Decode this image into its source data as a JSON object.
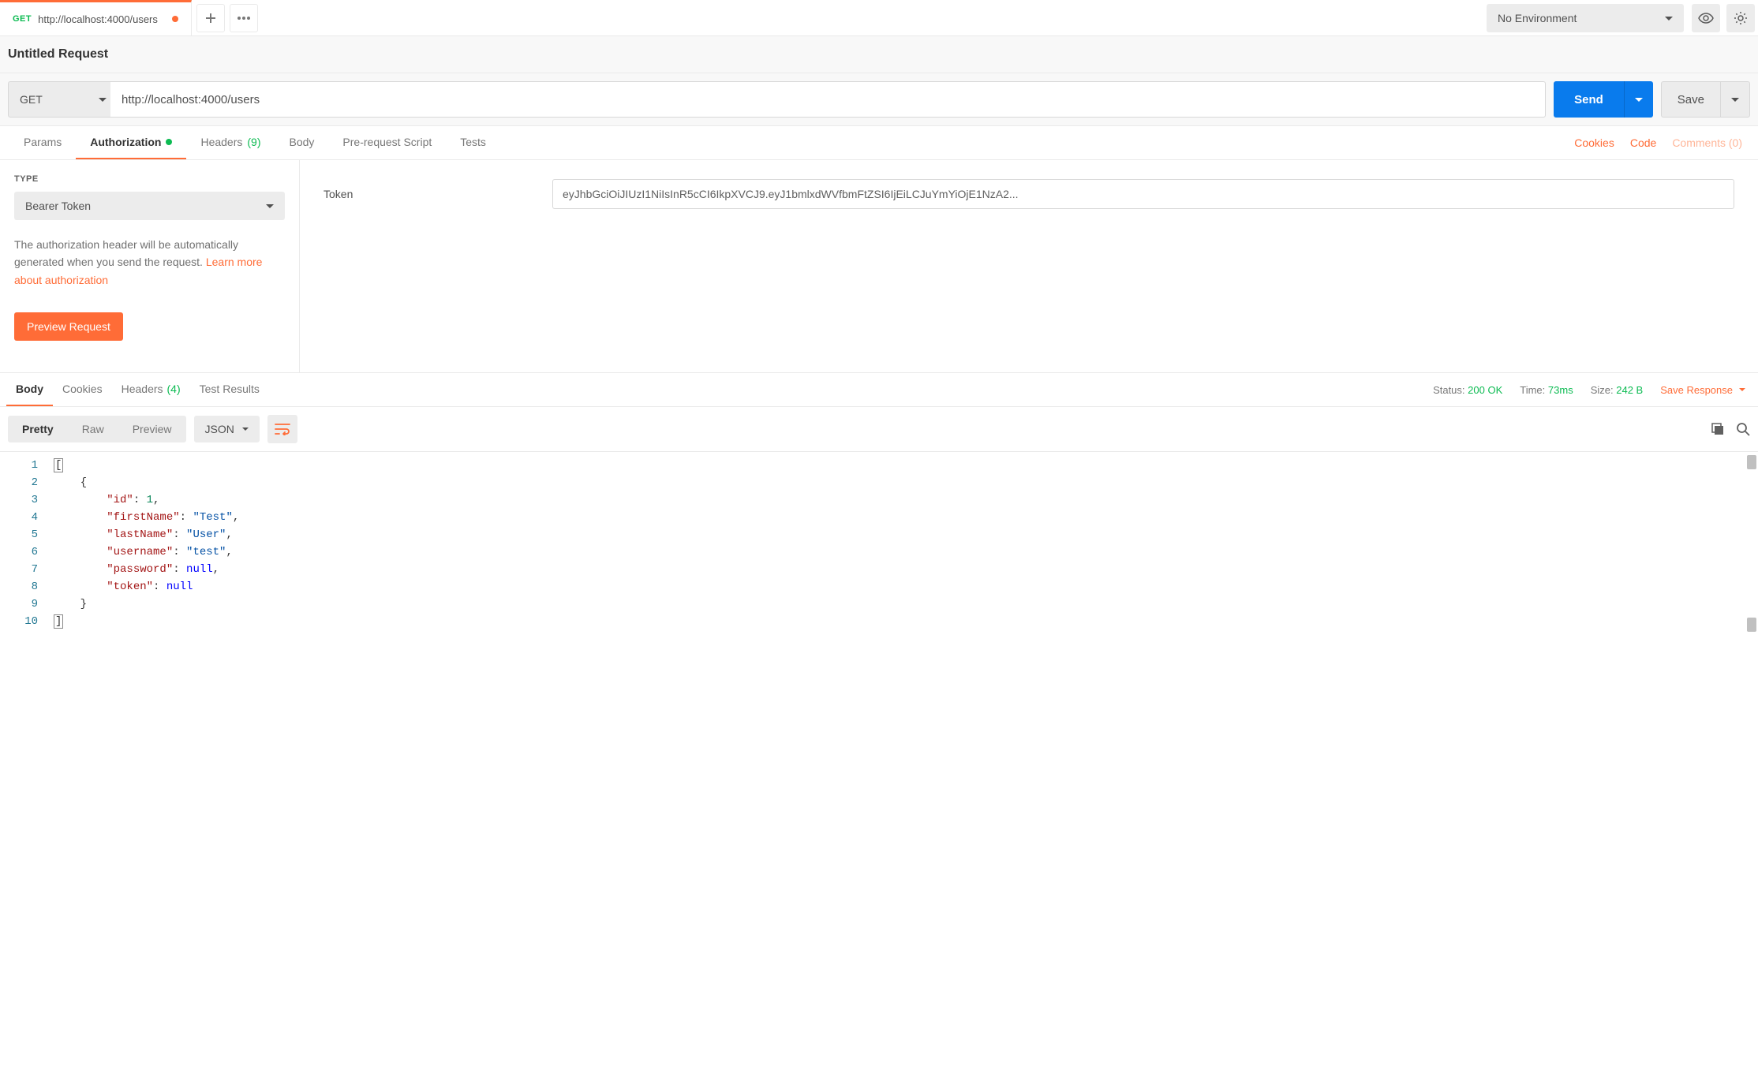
{
  "tab": {
    "method": "GET",
    "url": "http://localhost:4000/users"
  },
  "env": {
    "selected": "No Environment"
  },
  "request": {
    "title": "Untitled Request"
  },
  "urlbar": {
    "method": "GET",
    "url": "http://localhost:4000/users",
    "send": "Send",
    "save": "Save"
  },
  "reqTabs": {
    "params": "Params",
    "authorization": "Authorization",
    "headers": "Headers",
    "headersCount": "(9)",
    "body": "Body",
    "prerequest": "Pre-request Script",
    "tests": "Tests"
  },
  "rightLinks": {
    "cookies": "Cookies",
    "code": "Code",
    "comments": "Comments (0)"
  },
  "auth": {
    "typeLabel": "TYPE",
    "typeValue": "Bearer Token",
    "note1": "The authorization header will be automatically generated when you send the request. ",
    "learnMore": "Learn more about authorization",
    "previewBtn": "Preview Request",
    "tokenLabel": "Token",
    "tokenValue": "eyJhbGciOiJIUzI1NiIsInR5cCI6IkpXVCJ9.eyJ1bmlxdWVfbmFtZSI6IjEiLCJuYmYiOjE1NzA2..."
  },
  "respTabs": {
    "body": "Body",
    "cookies": "Cookies",
    "headers": "Headers",
    "headersCount": "(4)",
    "testResults": "Test Results"
  },
  "respMeta": {
    "statusLabel": "Status:",
    "statusVal": "200 OK",
    "timeLabel": "Time:",
    "timeVal": "73ms",
    "sizeLabel": "Size:",
    "sizeVal": "242 B",
    "saveResponse": "Save Response"
  },
  "view": {
    "pretty": "Pretty",
    "raw": "Raw",
    "preview": "Preview",
    "format": "JSON"
  },
  "gutter": [
    "1",
    "2",
    "3",
    "4",
    "5",
    "6",
    "7",
    "8",
    "9",
    "10"
  ],
  "code": {
    "l3k": "\"id\"",
    "l3v": "1",
    "l4k": "\"firstName\"",
    "l4v": "\"Test\"",
    "l5k": "\"lastName\"",
    "l5v": "\"User\"",
    "l6k": "\"username\"",
    "l6v": "\"test\"",
    "l7k": "\"password\"",
    "l7v": "null",
    "l8k": "\"token\"",
    "l8v": "null"
  }
}
